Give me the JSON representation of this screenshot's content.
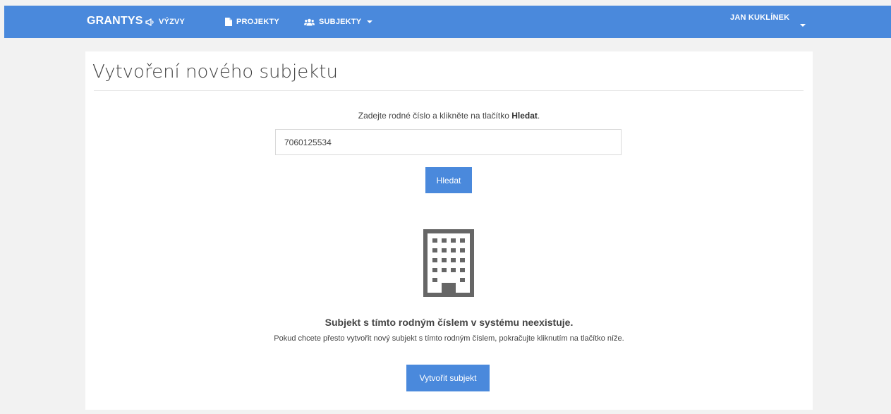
{
  "navbar": {
    "brand": "GRANTYS",
    "items": [
      {
        "label": "VÝZVY",
        "icon": "megaphone-icon"
      },
      {
        "label": "PROJEKTY",
        "icon": "document-icon"
      },
      {
        "label": "SUBJEKTY",
        "icon": "users-icon"
      }
    ],
    "user": "JAN KUKLÍNEK"
  },
  "page": {
    "title": "Vytvoření nového subjektu",
    "instruction_prefix": "Zadejte rodné číslo a klikněte na tlačítko ",
    "instruction_bold": "Hledat",
    "instruction_suffix": ".",
    "search": {
      "value": "7060125534",
      "placeholder": ""
    },
    "search_button": "Hledat",
    "result_icon": "building-icon",
    "not_found_title": "Subjekt s tímto rodným číslem v systému neexistuje.",
    "not_found_hint": "Pokud chcete přesto vytvořit nový subjekt s tímto rodným číslem, pokračujte kliknutím na tlačítko níže.",
    "create_button": "Vytvořit subjekt"
  },
  "colors": {
    "accent": "#4a89dc",
    "background": "#f2f2f2",
    "panel": "#ffffff",
    "icon": "#666666"
  }
}
